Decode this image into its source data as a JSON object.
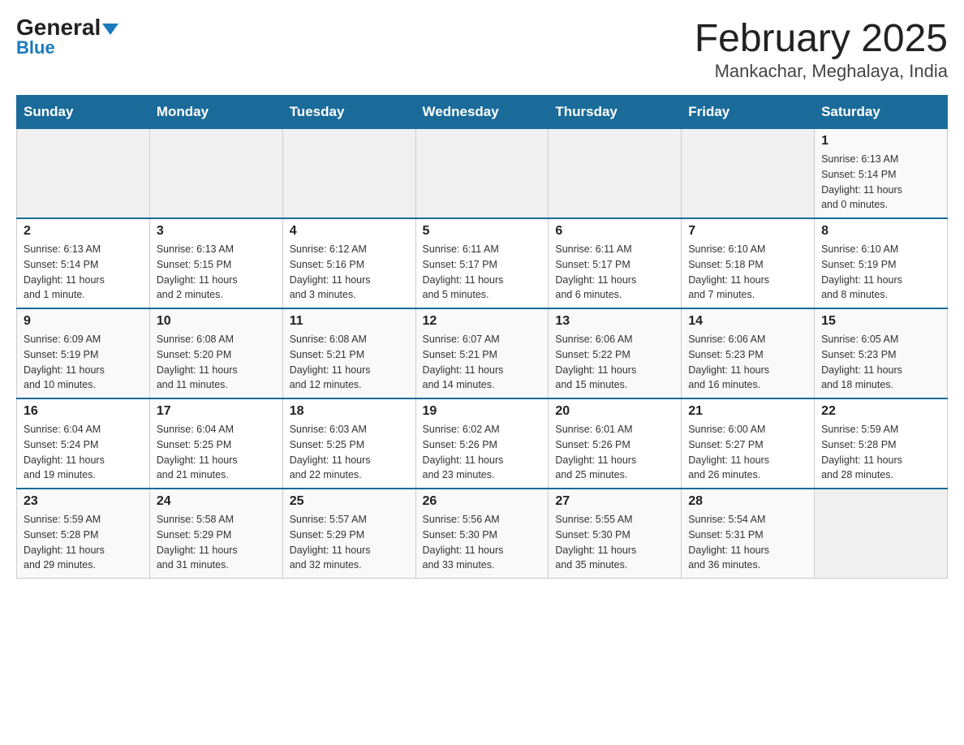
{
  "header": {
    "logo_general": "General",
    "logo_blue": "Blue",
    "title": "February 2025",
    "subtitle": "Mankachar, Meghalaya, India"
  },
  "days_of_week": [
    "Sunday",
    "Monday",
    "Tuesday",
    "Wednesday",
    "Thursday",
    "Friday",
    "Saturday"
  ],
  "weeks": [
    [
      {
        "day": "",
        "info": ""
      },
      {
        "day": "",
        "info": ""
      },
      {
        "day": "",
        "info": ""
      },
      {
        "day": "",
        "info": ""
      },
      {
        "day": "",
        "info": ""
      },
      {
        "day": "",
        "info": ""
      },
      {
        "day": "1",
        "info": "Sunrise: 6:13 AM\nSunset: 5:14 PM\nDaylight: 11 hours\nand 0 minutes."
      }
    ],
    [
      {
        "day": "2",
        "info": "Sunrise: 6:13 AM\nSunset: 5:14 PM\nDaylight: 11 hours\nand 1 minute."
      },
      {
        "day": "3",
        "info": "Sunrise: 6:13 AM\nSunset: 5:15 PM\nDaylight: 11 hours\nand 2 minutes."
      },
      {
        "day": "4",
        "info": "Sunrise: 6:12 AM\nSunset: 5:16 PM\nDaylight: 11 hours\nand 3 minutes."
      },
      {
        "day": "5",
        "info": "Sunrise: 6:11 AM\nSunset: 5:17 PM\nDaylight: 11 hours\nand 5 minutes."
      },
      {
        "day": "6",
        "info": "Sunrise: 6:11 AM\nSunset: 5:17 PM\nDaylight: 11 hours\nand 6 minutes."
      },
      {
        "day": "7",
        "info": "Sunrise: 6:10 AM\nSunset: 5:18 PM\nDaylight: 11 hours\nand 7 minutes."
      },
      {
        "day": "8",
        "info": "Sunrise: 6:10 AM\nSunset: 5:19 PM\nDaylight: 11 hours\nand 8 minutes."
      }
    ],
    [
      {
        "day": "9",
        "info": "Sunrise: 6:09 AM\nSunset: 5:19 PM\nDaylight: 11 hours\nand 10 minutes."
      },
      {
        "day": "10",
        "info": "Sunrise: 6:08 AM\nSunset: 5:20 PM\nDaylight: 11 hours\nand 11 minutes."
      },
      {
        "day": "11",
        "info": "Sunrise: 6:08 AM\nSunset: 5:21 PM\nDaylight: 11 hours\nand 12 minutes."
      },
      {
        "day": "12",
        "info": "Sunrise: 6:07 AM\nSunset: 5:21 PM\nDaylight: 11 hours\nand 14 minutes."
      },
      {
        "day": "13",
        "info": "Sunrise: 6:06 AM\nSunset: 5:22 PM\nDaylight: 11 hours\nand 15 minutes."
      },
      {
        "day": "14",
        "info": "Sunrise: 6:06 AM\nSunset: 5:23 PM\nDaylight: 11 hours\nand 16 minutes."
      },
      {
        "day": "15",
        "info": "Sunrise: 6:05 AM\nSunset: 5:23 PM\nDaylight: 11 hours\nand 18 minutes."
      }
    ],
    [
      {
        "day": "16",
        "info": "Sunrise: 6:04 AM\nSunset: 5:24 PM\nDaylight: 11 hours\nand 19 minutes."
      },
      {
        "day": "17",
        "info": "Sunrise: 6:04 AM\nSunset: 5:25 PM\nDaylight: 11 hours\nand 21 minutes."
      },
      {
        "day": "18",
        "info": "Sunrise: 6:03 AM\nSunset: 5:25 PM\nDaylight: 11 hours\nand 22 minutes."
      },
      {
        "day": "19",
        "info": "Sunrise: 6:02 AM\nSunset: 5:26 PM\nDaylight: 11 hours\nand 23 minutes."
      },
      {
        "day": "20",
        "info": "Sunrise: 6:01 AM\nSunset: 5:26 PM\nDaylight: 11 hours\nand 25 minutes."
      },
      {
        "day": "21",
        "info": "Sunrise: 6:00 AM\nSunset: 5:27 PM\nDaylight: 11 hours\nand 26 minutes."
      },
      {
        "day": "22",
        "info": "Sunrise: 5:59 AM\nSunset: 5:28 PM\nDaylight: 11 hours\nand 28 minutes."
      }
    ],
    [
      {
        "day": "23",
        "info": "Sunrise: 5:59 AM\nSunset: 5:28 PM\nDaylight: 11 hours\nand 29 minutes."
      },
      {
        "day": "24",
        "info": "Sunrise: 5:58 AM\nSunset: 5:29 PM\nDaylight: 11 hours\nand 31 minutes."
      },
      {
        "day": "25",
        "info": "Sunrise: 5:57 AM\nSunset: 5:29 PM\nDaylight: 11 hours\nand 32 minutes."
      },
      {
        "day": "26",
        "info": "Sunrise: 5:56 AM\nSunset: 5:30 PM\nDaylight: 11 hours\nand 33 minutes."
      },
      {
        "day": "27",
        "info": "Sunrise: 5:55 AM\nSunset: 5:30 PM\nDaylight: 11 hours\nand 35 minutes."
      },
      {
        "day": "28",
        "info": "Sunrise: 5:54 AM\nSunset: 5:31 PM\nDaylight: 11 hours\nand 36 minutes."
      },
      {
        "day": "",
        "info": ""
      }
    ]
  ]
}
